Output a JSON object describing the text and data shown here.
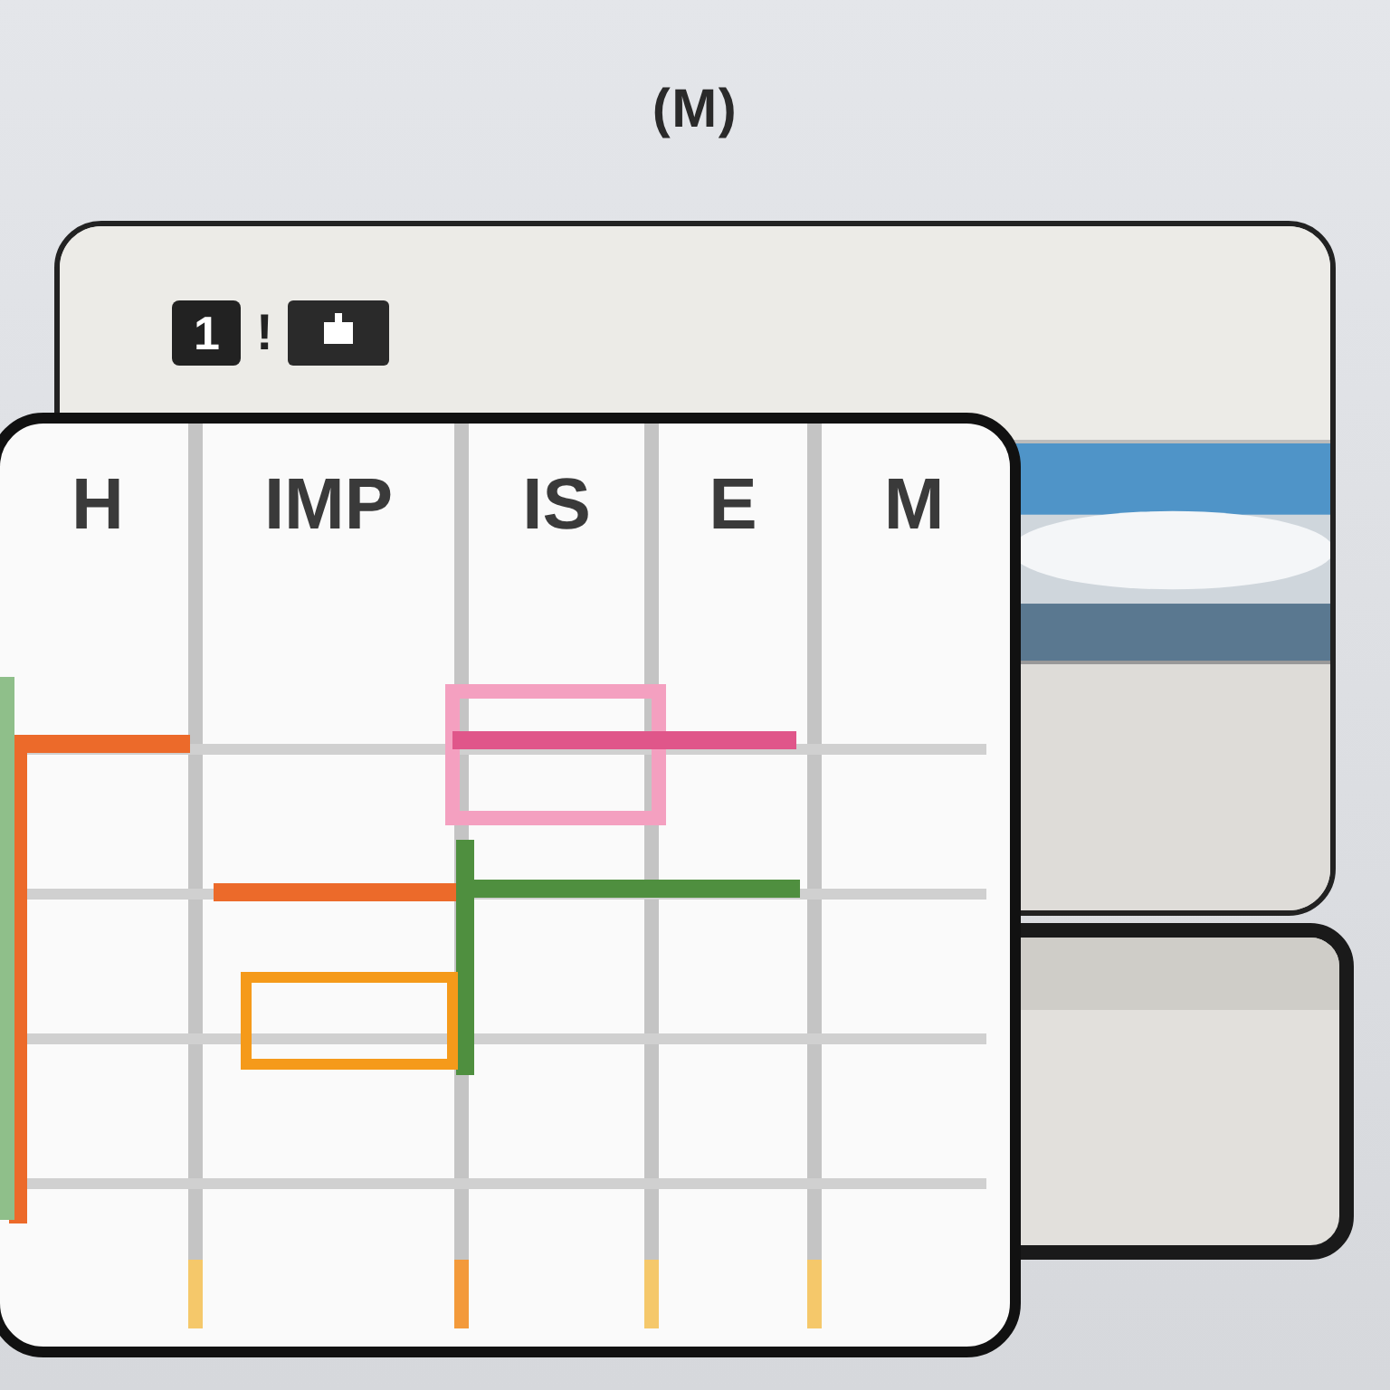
{
  "title": "(M)",
  "back_window": {
    "badge": "1",
    "alert": "!"
  },
  "calendar": {
    "columns": [
      "H",
      "IMP",
      "IS",
      "E",
      "M"
    ]
  }
}
